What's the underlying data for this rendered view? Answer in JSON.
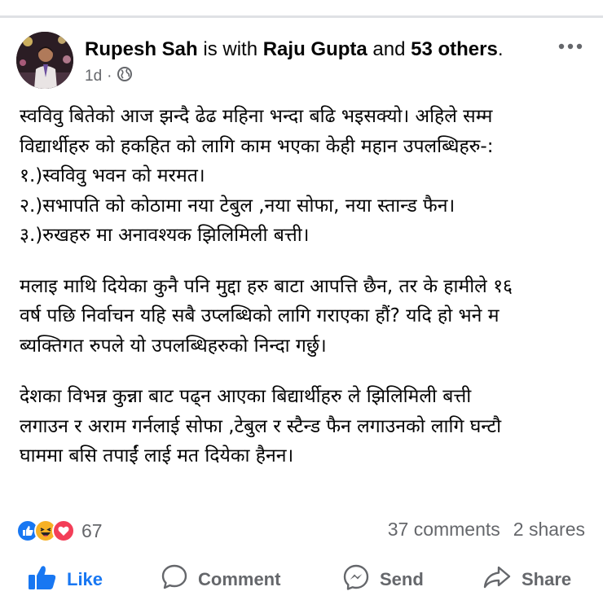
{
  "post": {
    "author": "Rupesh Sah",
    "with_text": " is with ",
    "tagged": "Raju Gupta",
    "and_text": " and ",
    "others": "53 others",
    "period": ".",
    "time": "1d",
    "dot": "·",
    "privacy_icon": "globe-icon",
    "more_icon": "more-options-icon",
    "body": {
      "line1": "स्वविवु बितेको आज झन्दै ढेढ महिना भन्दा बढि भइसक्यो। अहिले सम्म",
      "line2": "विद्यार्थीहरु को हकहित को लागि काम भएका केही महान उपलब्धिहरु-:",
      "line3": "१.)स्वविवु भवन को मरमत।",
      "line4": "२.)सभापति को कोठामा नया टेबुल ,नया सोफा, नया स्तान्ड फैन।",
      "line5": "३.)रुखहरु मा अनावश्यक झिलिमिली बत्ती।",
      "line6": " मलाइ माथि दियेका कुनै पनि मुद्दा हरु बाटा आपत्ति छैन, तर के हामीले १६",
      "line7": "वर्ष पछि निर्वाचन यहि सबै उप्लब्धिको लागि गराएका हौं? यदि हो भने म",
      "line8": "ब्यक्तिगत रुपले यो उपलब्धिहरुको निन्दा गर्छु।",
      "line9": " देशका विभन्न कुन्ना बाट पढ्न आएका  बिद्यार्थीहरु ले झिलिमिली बत्ती",
      "line10": "लगाउन र अराम गर्नलाई सोफा ,टेबुल र स्टैन्ड फैन लगाउनको लागि घन्टौ",
      "line11": "घाममा बसि तपाईं लाई मत दियेका हैनन।"
    },
    "reactions": {
      "icons": [
        "like-icon",
        "haha-icon",
        "love-icon"
      ],
      "count": "67"
    },
    "comments": "37 comments",
    "shares": "2 shares",
    "actions": {
      "like": "Like",
      "comment": "Comment",
      "send": "Send",
      "share": "Share"
    }
  },
  "colors": {
    "brand_blue": "#1877f2",
    "muted": "#65676b",
    "haha": "#f7b125",
    "love": "#f33e58"
  }
}
